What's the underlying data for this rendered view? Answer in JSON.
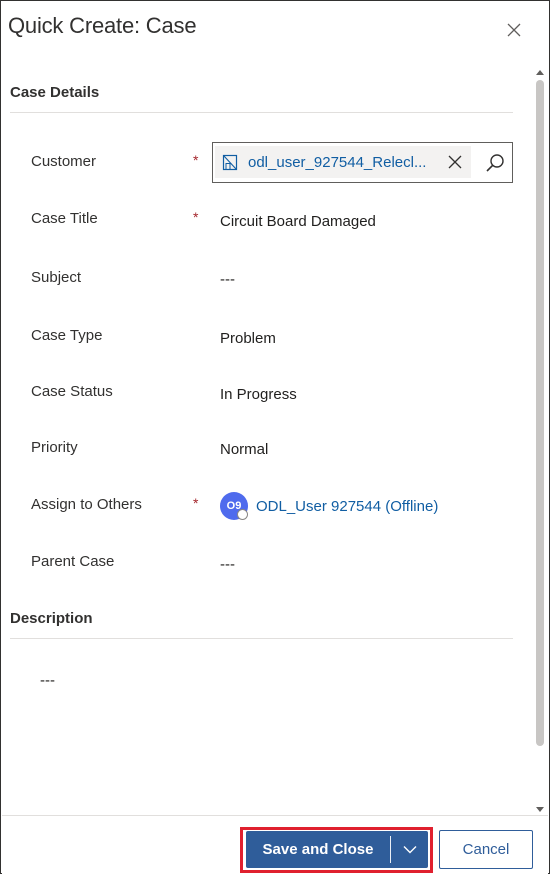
{
  "dialog": {
    "title": "Quick Create: Case"
  },
  "sections": {
    "case_details": "Case Details",
    "description": "Description"
  },
  "fields": {
    "customer": {
      "label": "Customer",
      "required": "*",
      "value": "odl_user_927544_Relecl..."
    },
    "case_title": {
      "label": "Case Title",
      "required": "*",
      "value": "Circuit Board Damaged"
    },
    "subject": {
      "label": "Subject",
      "value": "---"
    },
    "case_type": {
      "label": "Case Type",
      "value": "Problem"
    },
    "case_status": {
      "label": "Case Status",
      "value": "In Progress"
    },
    "priority": {
      "label": "Priority",
      "value": "Normal"
    },
    "assign_to_others": {
      "label": "Assign to Others",
      "required": "*",
      "avatar_initials": "O9",
      "value": "ODL_User 927544 (Offline)"
    },
    "parent_case": {
      "label": "Parent Case",
      "value": "---"
    },
    "description": {
      "value": "---"
    }
  },
  "footer": {
    "save_label": "Save and Close",
    "cancel_label": "Cancel"
  },
  "icons": {
    "close": "close-icon",
    "account": "account-icon",
    "remove": "remove-icon",
    "search": "search-icon",
    "chevron": "chevron-down-icon"
  },
  "colors": {
    "accent": "#2f5d9a",
    "link": "#115ea3",
    "required": "#a4262c",
    "highlight": "#e0202f",
    "avatar": "#4f6bed"
  }
}
